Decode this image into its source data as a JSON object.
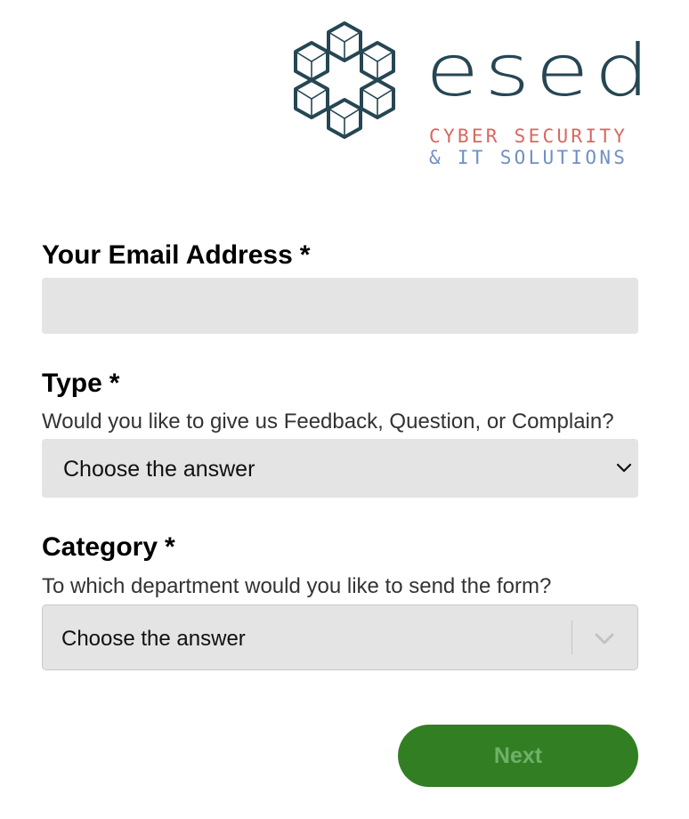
{
  "logo": {
    "wordmark": "esed",
    "tagline_line1": "CYBER SECURITY",
    "tagline_line2": "& IT SOLUTIONS",
    "colors": {
      "wordmark": "#264653",
      "tagline_line1": "#d9675f",
      "tagline_line2": "#6f8fc4"
    },
    "icon": "hexagon-cube-cluster-icon"
  },
  "form": {
    "email": {
      "label": "Your Email Address",
      "required_marker": "*",
      "value": "",
      "placeholder": ""
    },
    "type": {
      "label": "Type",
      "required_marker": "*",
      "hint": "Would you like to give us Feedback, Question, or Complain?",
      "selected": "Choose the answer",
      "icon": "chevron-down-icon"
    },
    "category": {
      "label": "Category",
      "required_marker": "*",
      "hint": "To which department would you like to send the form?",
      "selected": "Choose the answer",
      "icon": "chevron-down-icon"
    },
    "next_label": "Next"
  },
  "colors": {
    "field_background": "#e5e4e5",
    "button_background": "#327f23",
    "button_text": "#6fb169"
  }
}
